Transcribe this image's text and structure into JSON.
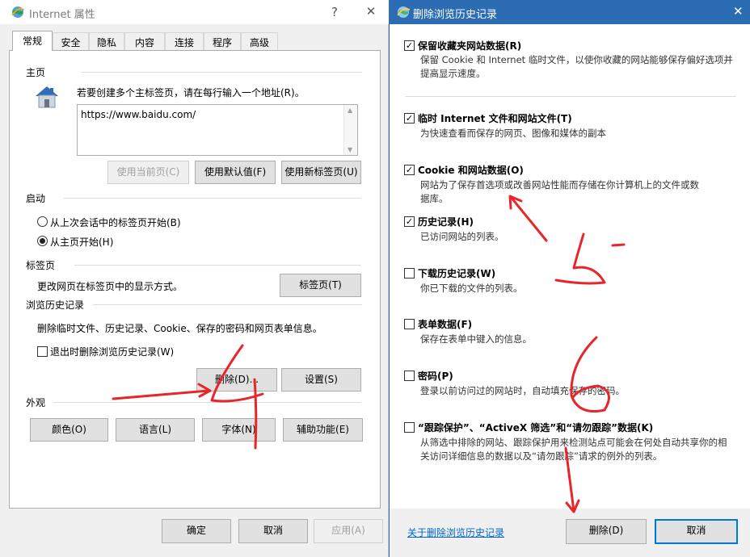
{
  "left_window": {
    "title": "Internet 属性",
    "help_glyph": "?",
    "close_glyph": "✕",
    "tabs": [
      {
        "label": "常规",
        "active": true
      },
      {
        "label": "安全",
        "active": false
      },
      {
        "label": "隐私",
        "active": false
      },
      {
        "label": "内容",
        "active": false
      },
      {
        "label": "连接",
        "active": false
      },
      {
        "label": "程序",
        "active": false
      },
      {
        "label": "高级",
        "active": false
      }
    ],
    "homepage": {
      "group_label": "主页",
      "instruction": "若要创建多个主标签页，请在每行输入一个地址(R)。",
      "url_value": "https://www.baidu.com/",
      "btn_use_current": "使用当前页(C)",
      "btn_use_default": "使用默认值(F)",
      "btn_use_new_tab": "使用新标签页(U)"
    },
    "startup": {
      "group_label": "启动",
      "option_last_session": "从上次会话中的标签页开始(B)",
      "option_homepage": "从主页开始(H)",
      "selected": "homepage"
    },
    "tabs_group": {
      "group_label": "标签页",
      "description": "更改网页在标签页中的显示方式。",
      "button": "标签页(T)"
    },
    "history": {
      "group_label": "浏览历史记录",
      "description": "删除临时文件、历史记录、Cookie、保存的密码和网页表单信息。",
      "checkbox_label": "退出时删除浏览历史记录(W)",
      "checkbox_checked": false,
      "btn_delete": "删除(D)...",
      "btn_settings": "设置(S)"
    },
    "appearance": {
      "group_label": "外观",
      "btn_colors": "颜色(O)",
      "btn_languages": "语言(L)",
      "btn_fonts": "字体(N)",
      "btn_accessibility": "辅助功能(E)"
    },
    "footer": {
      "ok": "确定",
      "cancel": "取消",
      "apply": "应用(A)"
    }
  },
  "right_window": {
    "title": "删除浏览历史记录",
    "close_glyph": "✕",
    "options": [
      {
        "title": "保留收藏夹网站数据(R)",
        "desc1": "保留 Cookie 和 Internet 临时文件，以使你收藏的网站能够保存偏好选项并",
        "desc2": "提高显示速度。",
        "checked": true
      },
      {
        "title": "临时 Internet 文件和网站文件(T)",
        "desc1": "为快速查看而保存的网页、图像和媒体的副本",
        "desc2": "",
        "checked": true
      },
      {
        "title": "Cookie 和网站数据(O)",
        "desc1": "网站为了保存首选项或改善网站性能而存储在你计算机上的文件或数",
        "desc2": "据库。",
        "checked": true
      },
      {
        "title": "历史记录(H)",
        "desc1": "已访问网站的列表。",
        "desc2": "",
        "checked": true
      },
      {
        "title": "下载历史记录(W)",
        "desc1": "你已下载的文件的列表。",
        "desc2": "",
        "checked": false
      },
      {
        "title": "表单数据(F)",
        "desc1": "保存在表单中键入的信息。",
        "desc2": "",
        "checked": false
      },
      {
        "title": "密码(P)",
        "desc1": "登录以前访问过的网站时，自动填充保存的密码。",
        "desc2": "",
        "checked": false
      },
      {
        "title": "“跟踪保护”、“ActiveX 筛选”和“请勿跟踪”数据(K)",
        "desc1": "从筛选中排除的网站、跟踪保护用来检测站点可能会在何处自动共享你的相",
        "desc2": "关访问详细信息的数据以及“请勿跟踪”请求的例外的列表。",
        "checked": false
      }
    ],
    "footer": {
      "about_link": "关于删除浏览历史记录",
      "delete": "删除(D)",
      "cancel": "取消"
    }
  },
  "annotation_color": "#e8262a"
}
